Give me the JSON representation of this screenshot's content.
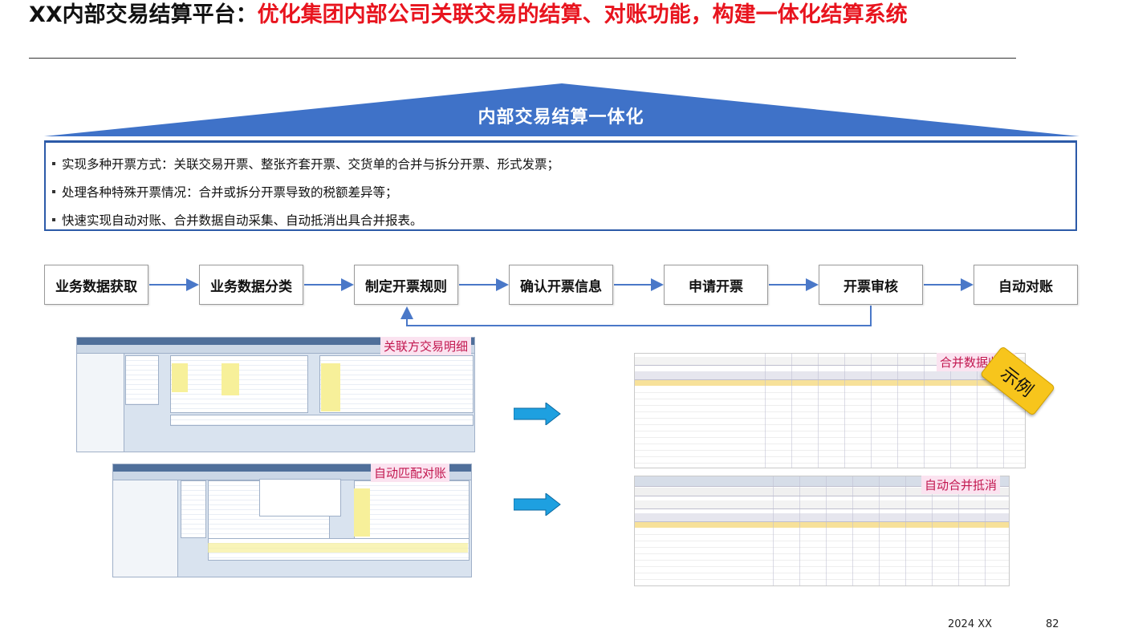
{
  "title": {
    "prefix": "XX内部交易结算平台：",
    "highlight": "优化集团内部公司关联交易的结算、对账功能，构建一体化结算系统"
  },
  "banner": {
    "label": "内部交易结算一体化"
  },
  "bullets": [
    "实现多种开票方式：关联交易开票、整张齐套开票、交货单的合并与拆分开票、形式发票；",
    "处理各种特殊开票情况：合并或拆分开票导致的税额差异等；",
    "快速实现自动对账、合并数据自动采集、自动抵消出具合并报表。"
  ],
  "flow_steps": [
    "业务数据获取",
    "业务数据分类",
    "制定开票规则",
    "确认开票信息",
    "申请开票",
    "开票审核",
    "自动对账"
  ],
  "screenshots": {
    "related_detail": "关联方交易明细",
    "auto_match": "自动匹配对账",
    "consolidation_collect": "合并数据收集",
    "auto_elimination": "自动合并抵消"
  },
  "stamp": "示例",
  "footer": {
    "year": "2024 XX",
    "page": "82"
  },
  "colors": {
    "title_red": "#e8141e",
    "banner_blue": "#3f72c8",
    "box_border": "#2c5aa8",
    "arrow_blue": "#4a78c8",
    "stamp_yellow": "#f7c51c"
  }
}
